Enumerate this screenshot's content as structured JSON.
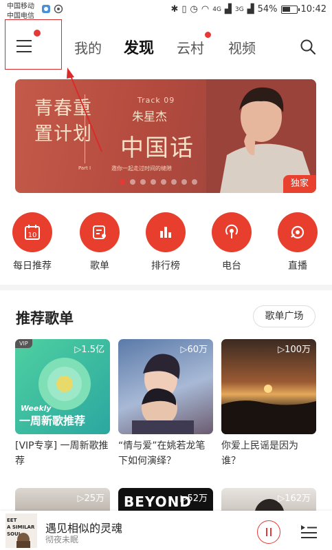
{
  "status": {
    "carrier1": "中国移动",
    "carrier2": "中国电信",
    "net1": "4G",
    "net2": "3G",
    "battery": "54%",
    "time": "10:42"
  },
  "nav": {
    "tabs": [
      "我的",
      "发现",
      "云村",
      "视频"
    ],
    "active_tab": "发现"
  },
  "banner": {
    "left_title": "青春重置计划",
    "part": "Part I",
    "track": "Track 09",
    "artist": "朱星杰",
    "song": "中国话",
    "subtitle": "邀你一起走过时间的缝隙",
    "badge": "独家",
    "dot_count": 8,
    "active_dot": 1
  },
  "quick": [
    {
      "label": "每日推荐",
      "icon": "calendar-icon",
      "day": "10"
    },
    {
      "label": "歌单",
      "icon": "playlist-icon"
    },
    {
      "label": "排行榜",
      "icon": "chart-icon"
    },
    {
      "label": "电台",
      "icon": "radio-icon"
    },
    {
      "label": "直播",
      "icon": "live-icon"
    }
  ],
  "recommend": {
    "title": "推荐歌单",
    "more": "歌单广场",
    "cards": [
      {
        "count": "▷1.5亿",
        "title": "[VIP专享] 一周新歌推荐",
        "vip": "VIP",
        "cover_text1": "Weekly",
        "cover_text2": "一周新歌推荐"
      },
      {
        "count": "▷60万",
        "title": "“情与爱”在姚若龙笔下如何演绎？"
      },
      {
        "count": "▷100万",
        "title": "你爱上民谣是因为谁？"
      }
    ],
    "row2_counts": [
      "▷25万",
      "▷52万",
      "▷162万"
    ],
    "row2_cover_text": "BEYOND"
  },
  "player": {
    "song": "遇见相似的灵魂",
    "artist": "彻夜未眠",
    "art_text": "EET A SIMILAR SOUL"
  },
  "colors": {
    "accent": "#e53935",
    "circle": "#e83e2d"
  }
}
